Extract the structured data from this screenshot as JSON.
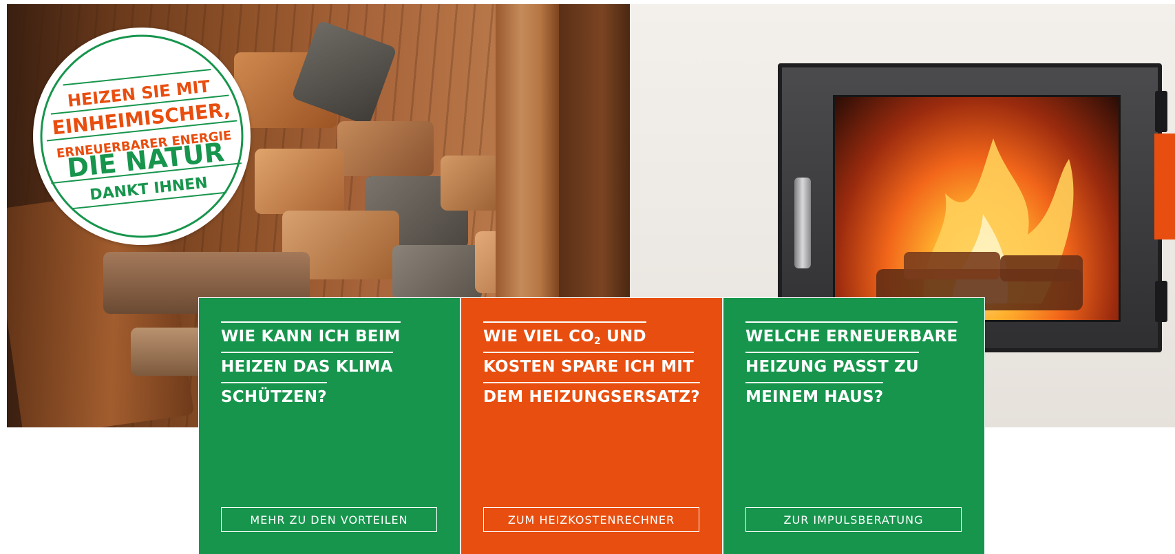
{
  "colors": {
    "green": "#17954d",
    "orange": "#e84e0f",
    "white": "#ffffff"
  },
  "badge": {
    "line1": "HEIZEN SIE MIT",
    "line2": "EINHEIMISCHER,",
    "line3": "ERNEUERBARER ENERGIE",
    "line4": "DIE NATUR",
    "line5": "DANKT IHNEN"
  },
  "cards": [
    {
      "color": "green",
      "title_lines": [
        "WIE KANN ICH BEIM",
        "HEIZEN DAS KLIMA",
        "SCHÜTZEN?"
      ],
      "button": "MEHR ZU DEN VORTEILEN"
    },
    {
      "color": "orange",
      "title_lines": [
        "WIE VIEL CO",
        "2",
        " UND",
        "KOSTEN SPARE ICH MIT",
        "DEM HEIZUNGSERSATZ?"
      ],
      "button": "ZUM HEIZKOSTENRECHNER"
    },
    {
      "color": "green",
      "title_lines": [
        "WELCHE ERNEUERBARE",
        "HEIZUNG PASST ZU",
        "MEINEM HAUS?"
      ],
      "button": "ZUR IMPULSBERATUNG"
    }
  ]
}
